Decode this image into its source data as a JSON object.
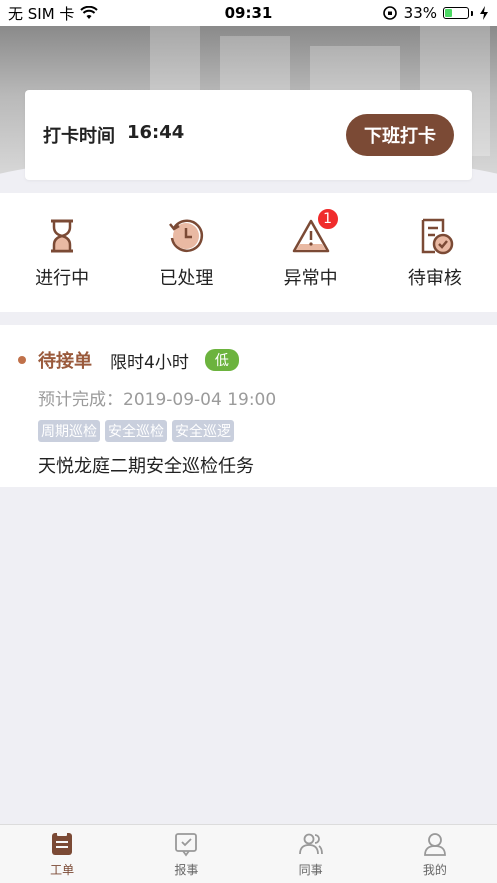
{
  "status_bar": {
    "carrier": "无 SIM 卡",
    "time": "09:31",
    "battery": "33%",
    "battery_level": 0.33
  },
  "punch": {
    "label": "打卡时间",
    "time": "16:44",
    "button": "下班打卡"
  },
  "statuses": [
    {
      "label": "进行中",
      "icon": "hourglass-icon"
    },
    {
      "label": "已处理",
      "icon": "history-clock-icon"
    },
    {
      "label": "异常中",
      "icon": "warning-icon",
      "badge": "1"
    },
    {
      "label": "待审核",
      "icon": "review-doc-icon"
    }
  ],
  "task": {
    "status": "待接单",
    "limit": "限时4小时",
    "priority": "低",
    "eta": "预计完成：2019-09-04 19:00",
    "tags": [
      "周期巡检",
      "安全巡检",
      "安全巡逻"
    ],
    "title": "天悦龙庭二期安全巡检任务"
  },
  "tabs": [
    {
      "label": "工单",
      "icon": "work-order-icon",
      "active": true
    },
    {
      "label": "报事",
      "icon": "report-icon",
      "active": false
    },
    {
      "label": "同事",
      "icon": "colleagues-icon",
      "active": false
    },
    {
      "label": "我的",
      "icon": "profile-icon",
      "active": false
    }
  ],
  "colors": {
    "brand": "#7b4a35",
    "priority_low": "#6cb33e",
    "badge": "#f02b2b",
    "tag": "#c9cfdd"
  }
}
